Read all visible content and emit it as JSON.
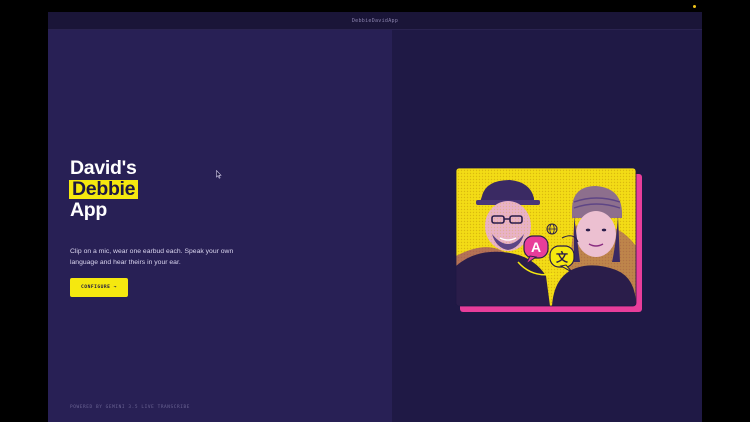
{
  "window": {
    "title": "DebbieDavidApp"
  },
  "hero": {
    "title_line1": "David's",
    "title_line2": "Debbie",
    "title_line3": "App",
    "subtitle": "Clip on a mic, wear one earbud each. Speak your own language and hear theirs in your ear.",
    "cta_label": "CONFIGURE →"
  },
  "footer": {
    "powered_by": "POWERED BY GEMINI 3.5 LIVE TRANSCRIBE"
  },
  "illustration": {
    "description_icon": "translate-icon",
    "bubble_left": "A",
    "bubble_right": "文"
  },
  "colors": {
    "accent": "#f5e80f",
    "pink": "#e83d9a",
    "background": "#1e1843",
    "left_pane": "#282055"
  }
}
